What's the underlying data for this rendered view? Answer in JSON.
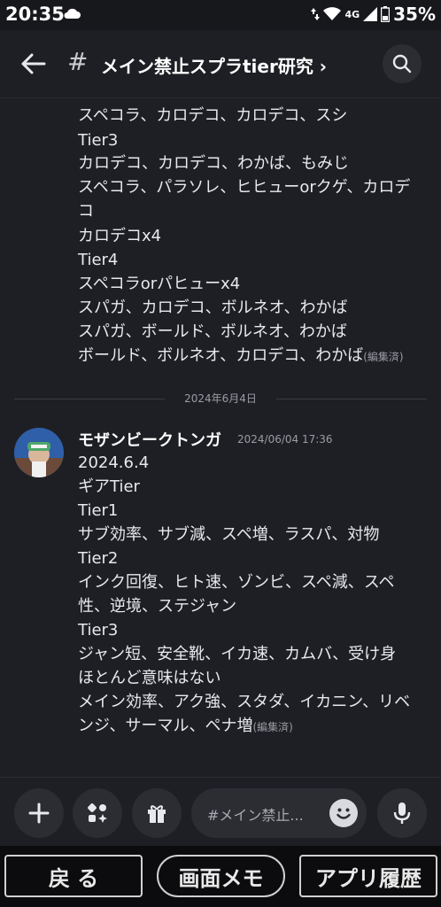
{
  "status": {
    "time": "20:35",
    "network": "4G",
    "battery": "35%"
  },
  "header": {
    "title": "メイン禁止スプラtier研究 ›"
  },
  "prev_message": {
    "lines": [
      "スペコラ、カロデコ、カロデコ、スシ",
      "Tier3",
      "カロデコ、カロデコ、わかば、もみじ",
      "スペコラ、パラソレ、ヒヒューorクゲ、カロデ",
      "コ",
      "カロデコx4",
      "Tier4",
      "スペコラorパヒューx4",
      "スパガ、カロデコ、ボルネオ、わかば",
      "スパガ、ボールド、ボルネオ、わかば",
      "ボールド、ボルネオ、カロデコ、わかば"
    ],
    "edited": "(編集済)"
  },
  "date_divider": "2024年6月4日",
  "message": {
    "author": "モザンビークトンガ",
    "timestamp": "2024/06/04 17:36",
    "lines": [
      "2024.6.4",
      "ギアTier",
      "Tier1",
      "サブ効率、サブ減、スペ増、ラスパ、対物",
      "Tier2",
      "インク回復、ヒト速、ゾンビ、スペ減、スペ",
      "性、逆境、ステジャン",
      "Tier3",
      "ジャン短、安全靴、イカ速、カムバ、受け身",
      "ほとんど意味はない",
      "メイン効率、アク強、スタダ、イカニン、リベ",
      "ンジ、サーマル、ペナ増"
    ],
    "edited": "(編集済)"
  },
  "composer": {
    "placeholder": "#メイン禁止..."
  },
  "navbar": {
    "back": "戻 る",
    "memo": "画面メモ",
    "history": "アプリ履歴"
  }
}
